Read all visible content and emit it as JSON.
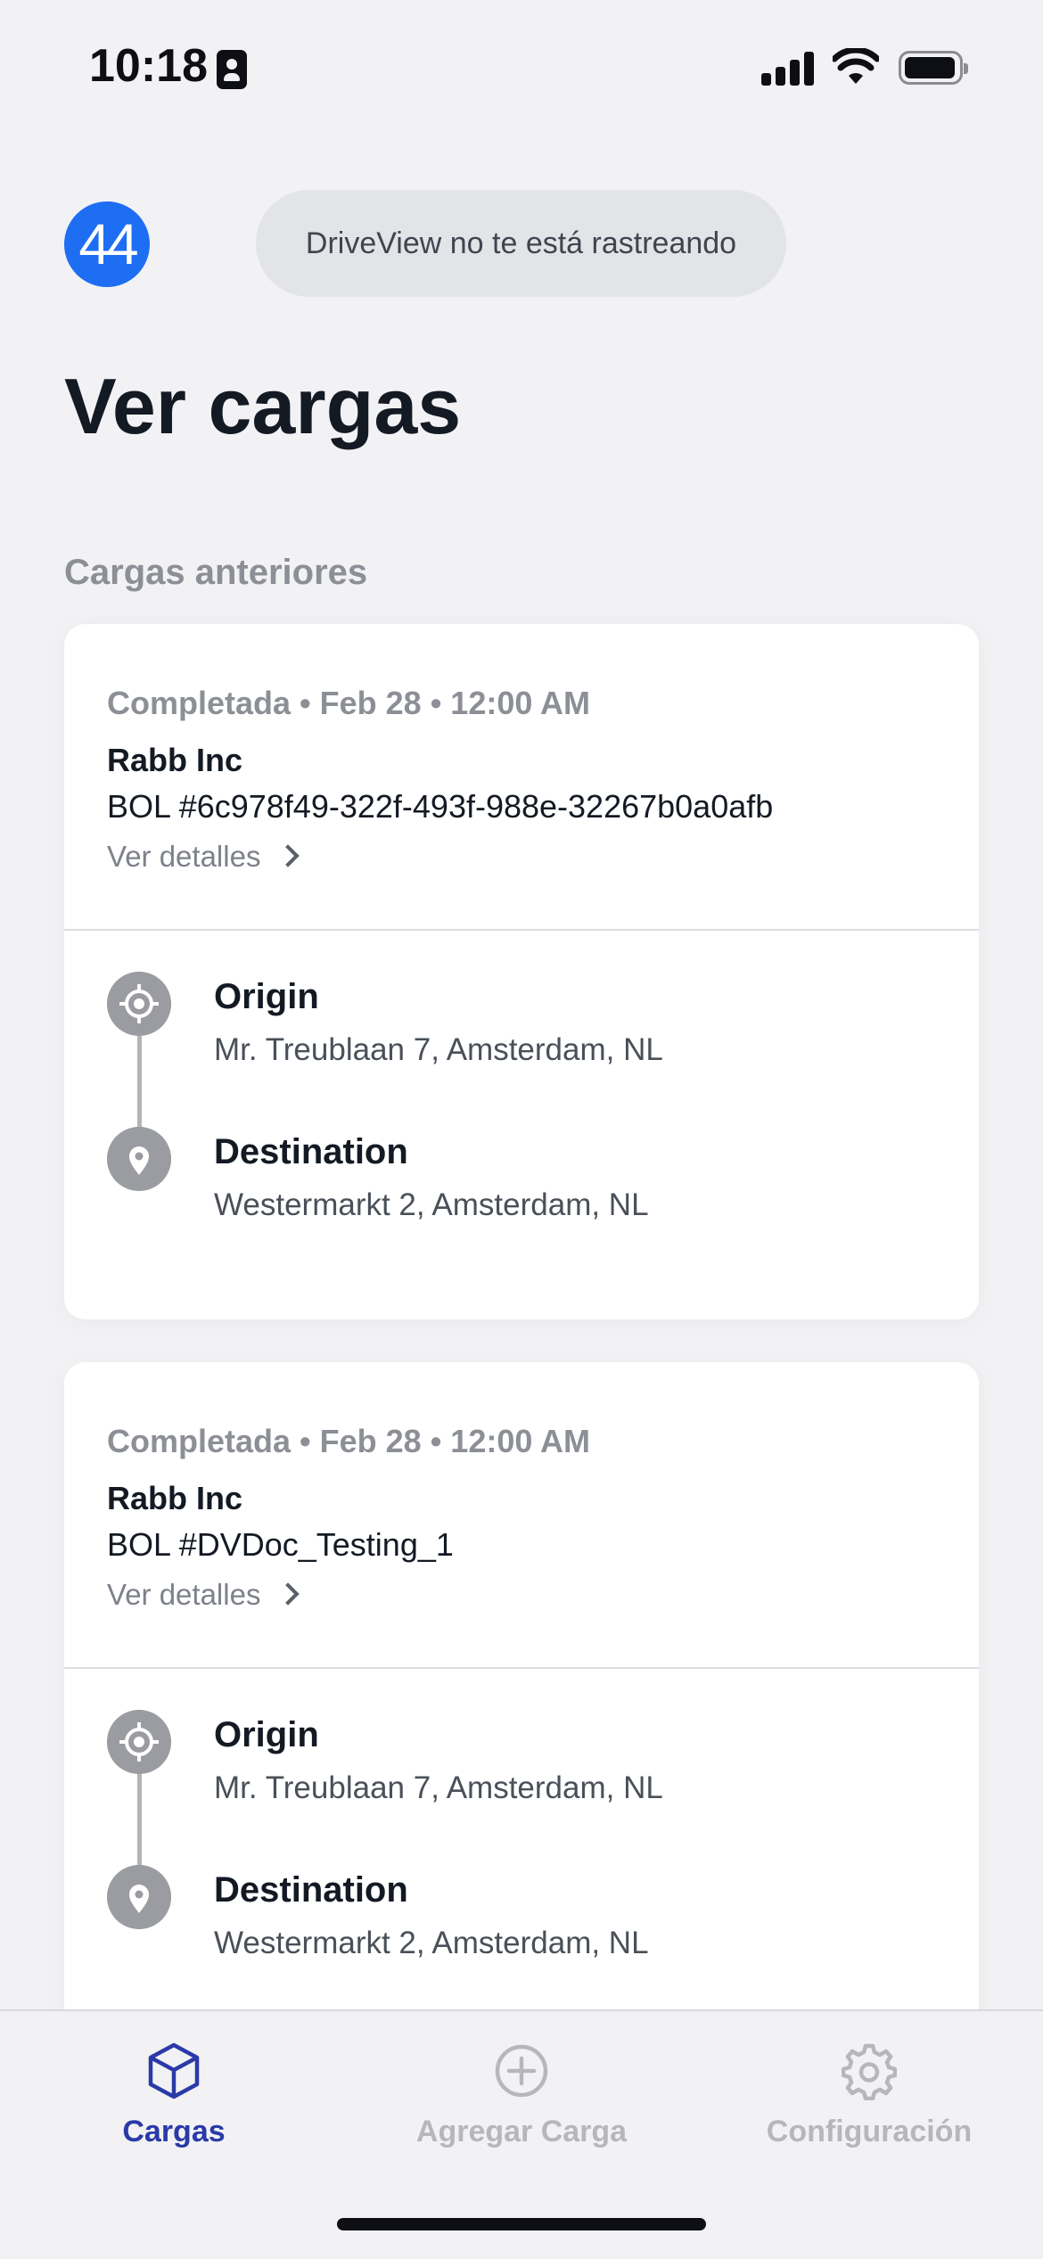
{
  "status_bar": {
    "time": "10:18"
  },
  "header": {
    "badge_text": "44",
    "tracking_text": "DriveView no te está rastreando",
    "title": "Ver cargas"
  },
  "section": {
    "label": "Cargas anteriores"
  },
  "loads": [
    {
      "meta": "Completada • Feb 28 • 12:00 AM",
      "company": "Rabb Inc",
      "bol": "BOL #6c978f49-322f-493f-988e-32267b0a0afb",
      "details_label": "Ver detalles",
      "origin_label": "Origin",
      "origin_address": "Mr. Treublaan 7, Amsterdam, NL",
      "destination_label": "Destination",
      "destination_address": "Westermarkt 2, Amsterdam, NL"
    },
    {
      "meta": "Completada • Feb 28 • 12:00 AM",
      "company": "Rabb Inc",
      "bol": "BOL #DVDoc_Testing_1",
      "details_label": "Ver detalles",
      "origin_label": "Origin",
      "origin_address": "Mr. Treublaan 7, Amsterdam, NL",
      "destination_label": "Destination",
      "destination_address": "Westermarkt 2, Amsterdam, NL"
    }
  ],
  "tabs": [
    {
      "label": "Cargas",
      "icon": "cube-icon",
      "active": true
    },
    {
      "label": "Agregar Carga",
      "icon": "plus-circle-icon",
      "active": false
    },
    {
      "label": "Configuración",
      "icon": "gear-icon",
      "active": false
    }
  ],
  "colors": {
    "accent": "#2a3aa8",
    "badge": "#1d6ef2",
    "inactive_tab": "#b5b7bc",
    "background": "#f2f2f4"
  }
}
